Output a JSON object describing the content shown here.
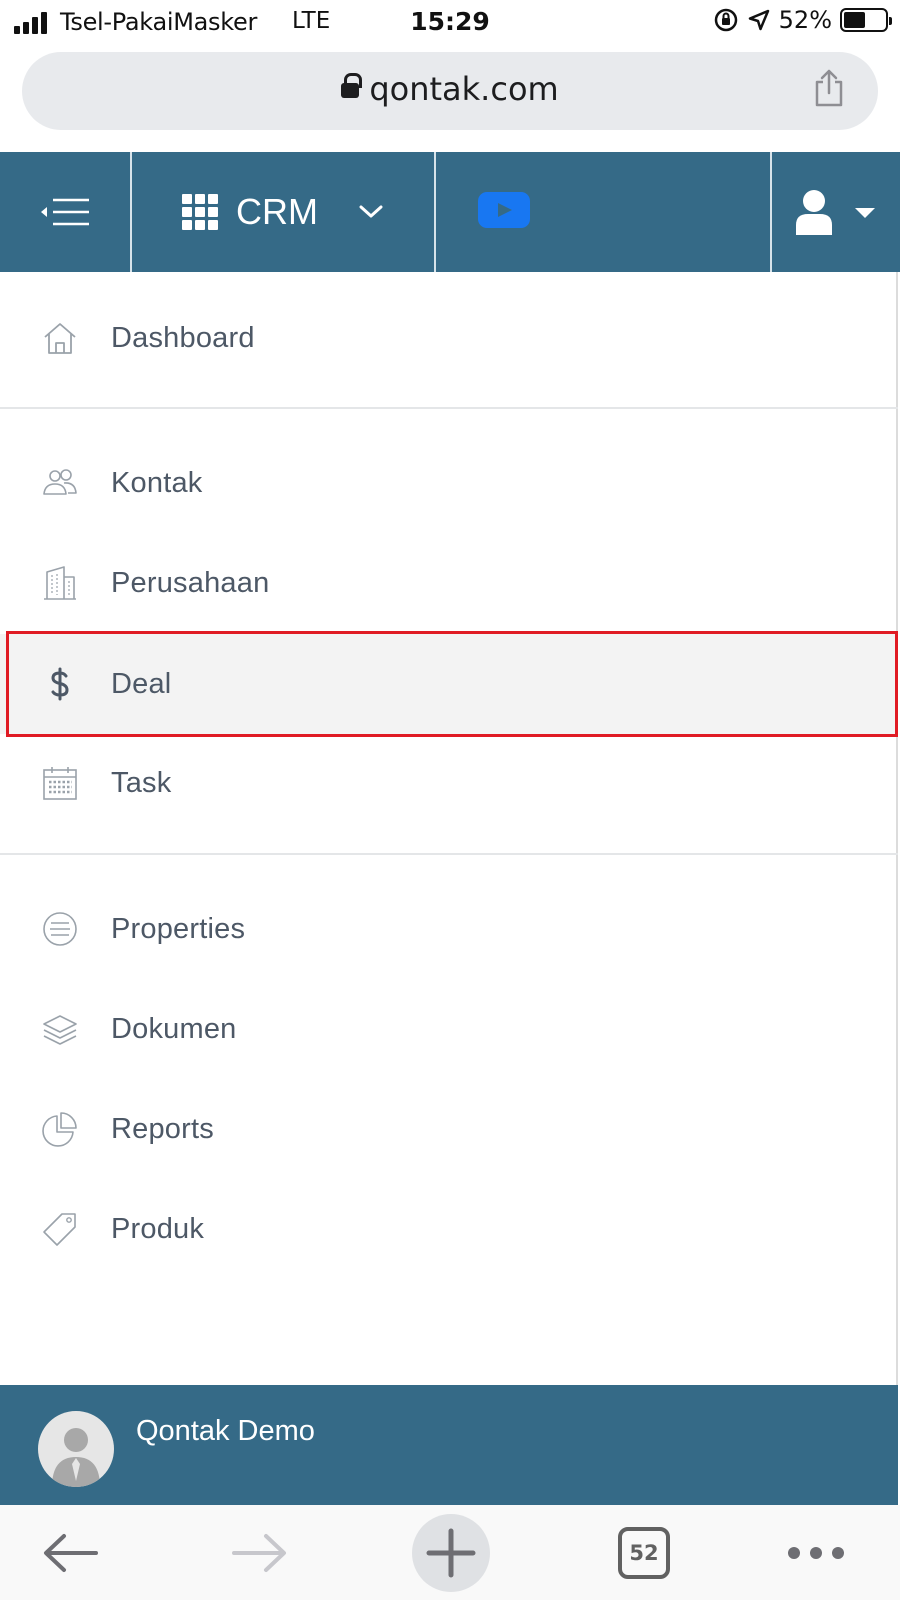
{
  "status_bar": {
    "carrier": "Tsel-PakaiMasker",
    "network": "LTE",
    "time": "15:29",
    "battery": "52%"
  },
  "browser": {
    "url": "qontak.com",
    "tab_count": "52"
  },
  "header": {
    "module_label": "CRM",
    "bg_color": "#356a87"
  },
  "menu": {
    "dashboard": "Dashboard",
    "kontak": "Kontak",
    "perusahaan": "Perusahaan",
    "deal": "Deal",
    "task": "Task",
    "properties": "Properties",
    "dokumen": "Dokumen",
    "reports": "Reports",
    "produk": "Produk",
    "selected": "Deal",
    "highlight_color": "#e01b24"
  },
  "footer": {
    "user_name": "Qontak Demo"
  },
  "icons": [
    "signal-icon",
    "battery-icon",
    "lock-icon",
    "share-icon",
    "menu-collapse-icon",
    "grid-icon",
    "chevron-down-icon",
    "youtube-icon",
    "user-icon",
    "caret-down-icon",
    "home-icon",
    "users-icon",
    "building-icon",
    "dollar-icon",
    "calendar-icon",
    "list-circle-icon",
    "layers-icon",
    "pie-chart-icon",
    "tag-icon",
    "back-arrow-icon",
    "forward-arrow-icon",
    "plus-icon",
    "more-icon"
  ]
}
